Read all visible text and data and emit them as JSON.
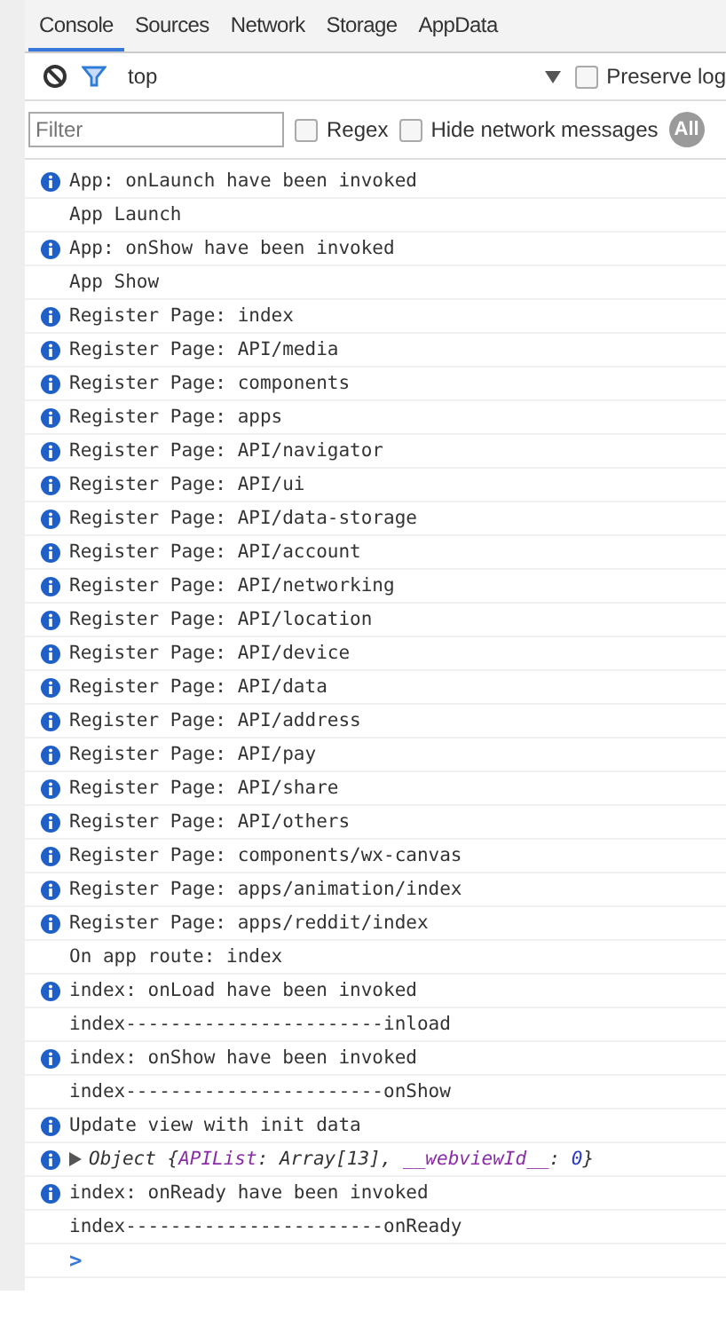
{
  "tabs": [
    {
      "label": "Console",
      "selected": true
    },
    {
      "label": "Sources",
      "selected": false
    },
    {
      "label": "Network",
      "selected": false
    },
    {
      "label": "Storage",
      "selected": false
    },
    {
      "label": "AppData",
      "selected": false
    }
  ],
  "toolbar": {
    "context": "top",
    "preserve_log": {
      "label": "Preserve log",
      "checked": false
    }
  },
  "filter_bar": {
    "placeholder": "Filter",
    "regex": {
      "label": "Regex",
      "checked": false
    },
    "hide_network": {
      "label": "Hide network messages",
      "checked": false
    },
    "level_button": "All"
  },
  "messages": [
    {
      "kind": "info",
      "text": "App: onLaunch have been invoked"
    },
    {
      "kind": "log",
      "text": "App Launch"
    },
    {
      "kind": "info",
      "text": "App: onShow have been invoked"
    },
    {
      "kind": "log",
      "text": "App Show"
    },
    {
      "kind": "info",
      "text": "Register Page: index"
    },
    {
      "kind": "info",
      "text": "Register Page: API/media"
    },
    {
      "kind": "info",
      "text": "Register Page: components"
    },
    {
      "kind": "info",
      "text": "Register Page: apps"
    },
    {
      "kind": "info",
      "text": "Register Page: API/navigator"
    },
    {
      "kind": "info",
      "text": "Register Page: API/ui"
    },
    {
      "kind": "info",
      "text": "Register Page: API/data-storage"
    },
    {
      "kind": "info",
      "text": "Register Page: API/account"
    },
    {
      "kind": "info",
      "text": "Register Page: API/networking"
    },
    {
      "kind": "info",
      "text": "Register Page: API/location"
    },
    {
      "kind": "info",
      "text": "Register Page: API/device"
    },
    {
      "kind": "info",
      "text": "Register Page: API/data"
    },
    {
      "kind": "info",
      "text": "Register Page: API/address"
    },
    {
      "kind": "info",
      "text": "Register Page: API/pay"
    },
    {
      "kind": "info",
      "text": "Register Page: API/share"
    },
    {
      "kind": "info",
      "text": "Register Page: API/others"
    },
    {
      "kind": "info",
      "text": "Register Page: components/wx-canvas"
    },
    {
      "kind": "info",
      "text": "Register Page: apps/animation/index"
    },
    {
      "kind": "info",
      "text": "Register Page: apps/reddit/index"
    },
    {
      "kind": "log",
      "text": "On app route: index"
    },
    {
      "kind": "info",
      "text": "index: onLoad have been invoked"
    },
    {
      "kind": "log",
      "text": "index-----------------------inload"
    },
    {
      "kind": "info",
      "text": "index: onShow have been invoked"
    },
    {
      "kind": "log",
      "text": "index-----------------------onShow"
    },
    {
      "kind": "info",
      "text": "Update view with init data"
    },
    {
      "kind": "object",
      "expanded": false,
      "parts": [
        {
          "kind": "plain",
          "text": "Object {"
        },
        {
          "kind": "key",
          "text": "APIList"
        },
        {
          "kind": "plain",
          "text": ": Array[13], "
        },
        {
          "kind": "key",
          "text": "__webviewId__"
        },
        {
          "kind": "plain",
          "text": ": "
        },
        {
          "kind": "number",
          "text": "0"
        },
        {
          "kind": "plain",
          "text": "}"
        }
      ]
    },
    {
      "kind": "info",
      "text": "index: onReady have been invoked"
    },
    {
      "kind": "log",
      "text": "index-----------------------onReady"
    }
  ],
  "prompt": ">"
}
